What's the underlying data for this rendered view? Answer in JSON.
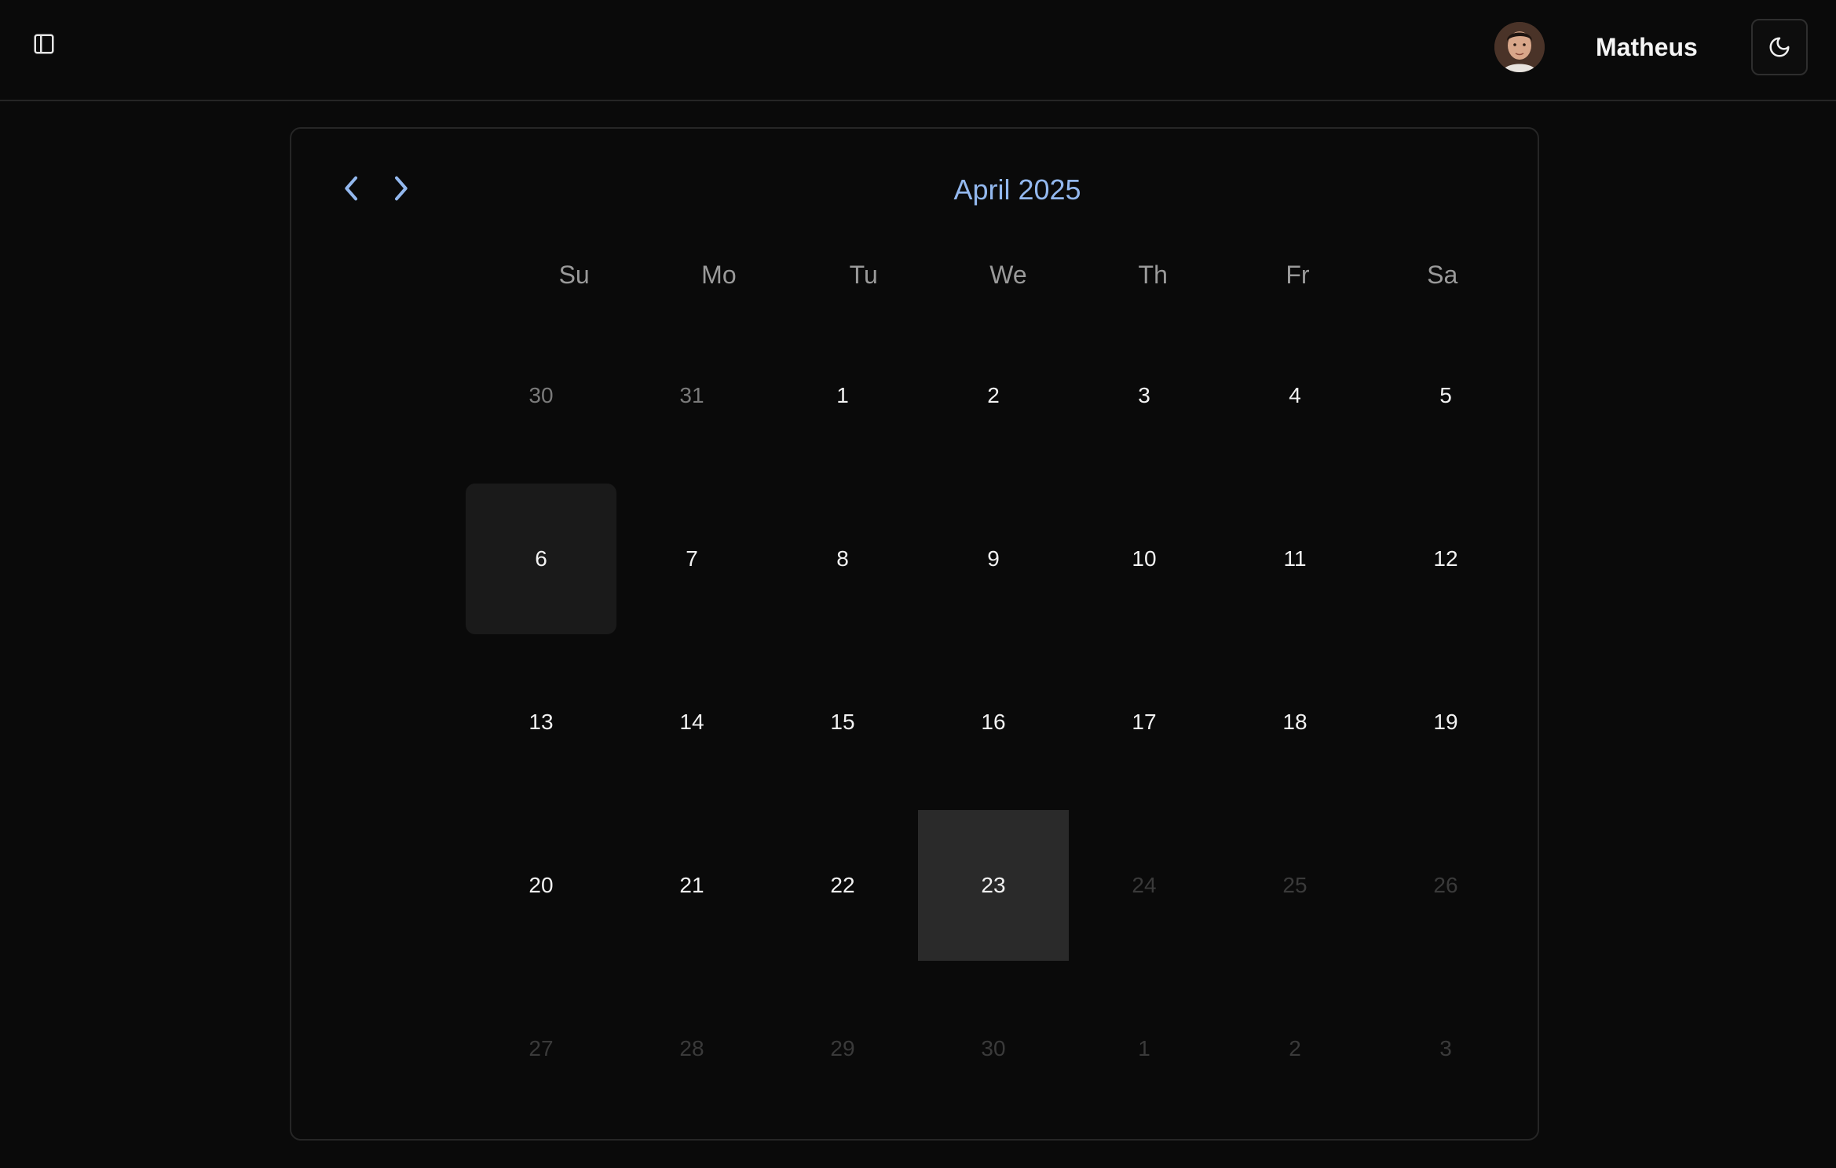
{
  "header": {
    "sidebar_toggle_icon": "panel-left-icon",
    "user_name": "Matheus",
    "theme_toggle_icon": "moon-icon"
  },
  "calendar": {
    "month_label": "April 2025",
    "prev_icon": "chevron-left-icon",
    "next_icon": "chevron-right-icon",
    "accent_color": "#93b8ee",
    "weekdays": [
      "Su",
      "Mo",
      "Tu",
      "We",
      "Th",
      "Fr",
      "Sa"
    ],
    "weeks": [
      [
        {
          "label": "30",
          "state": "outside"
        },
        {
          "label": "31",
          "state": "outside"
        },
        {
          "label": "1",
          "state": "normal"
        },
        {
          "label": "2",
          "state": "normal"
        },
        {
          "label": "3",
          "state": "normal"
        },
        {
          "label": "4",
          "state": "normal"
        },
        {
          "label": "5",
          "state": "normal"
        }
      ],
      [
        {
          "label": "6",
          "state": "today"
        },
        {
          "label": "7",
          "state": "normal"
        },
        {
          "label": "8",
          "state": "normal"
        },
        {
          "label": "9",
          "state": "normal"
        },
        {
          "label": "10",
          "state": "normal"
        },
        {
          "label": "11",
          "state": "normal"
        },
        {
          "label": "12",
          "state": "normal"
        }
      ],
      [
        {
          "label": "13",
          "state": "normal"
        },
        {
          "label": "14",
          "state": "normal"
        },
        {
          "label": "15",
          "state": "normal"
        },
        {
          "label": "16",
          "state": "normal"
        },
        {
          "label": "17",
          "state": "normal"
        },
        {
          "label": "18",
          "state": "normal"
        },
        {
          "label": "19",
          "state": "normal"
        }
      ],
      [
        {
          "label": "20",
          "state": "normal"
        },
        {
          "label": "21",
          "state": "normal"
        },
        {
          "label": "22",
          "state": "normal"
        },
        {
          "label": "23",
          "state": "selected"
        },
        {
          "label": "24",
          "state": "disabled"
        },
        {
          "label": "25",
          "state": "disabled"
        },
        {
          "label": "26",
          "state": "disabled"
        }
      ],
      [
        {
          "label": "27",
          "state": "disabled"
        },
        {
          "label": "28",
          "state": "disabled"
        },
        {
          "label": "29",
          "state": "disabled"
        },
        {
          "label": "30",
          "state": "disabled"
        },
        {
          "label": "1",
          "state": "disabled"
        },
        {
          "label": "2",
          "state": "disabled"
        },
        {
          "label": "3",
          "state": "disabled"
        }
      ]
    ]
  }
}
